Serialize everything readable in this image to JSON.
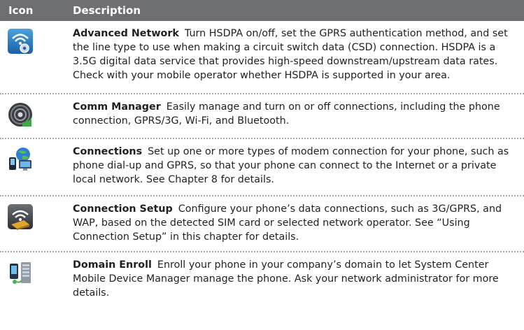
{
  "header": {
    "icon_label": "Icon",
    "desc_label": "Description"
  },
  "rows": [
    {
      "icon": "advanced-network-icon",
      "title": "Advanced Network",
      "text": "Turn HSDPA on/off, set the GPRS authentication method, and set the line type to use when making a circuit switch data (CSD) connection. HSDPA is a 3.5G digital data service that provides high-speed downstream/upstream data rates. Check with your mobile operator whether HSDPA is supported in your area."
    },
    {
      "icon": "comm-manager-icon",
      "title": "Comm Manager",
      "text": "Easily manage and turn on or off connections, including the phone connection, GPRS/3G, Wi-Fi, and Bluetooth."
    },
    {
      "icon": "connections-icon",
      "title": "Connections",
      "text": "Set up one or more types of modem connection for your phone, such as phone dial-up and GPRS, so that your phone can connect to the Internet or a private local network. See Chapter 8 for details."
    },
    {
      "icon": "connection-setup-icon",
      "title": "Connection Setup",
      "text": "Configure your phone’s data connections, such as 3G/GPRS, and WAP, based on the detected SIM card or selected network operator. See “Using Connection Setup” in this chapter for details."
    },
    {
      "icon": "domain-enroll-icon",
      "title": "Domain Enroll",
      "text": "Enroll your phone in your company’s domain to let System Center Mobile Device Manager manage the phone. Ask your network administrator for more details."
    }
  ]
}
